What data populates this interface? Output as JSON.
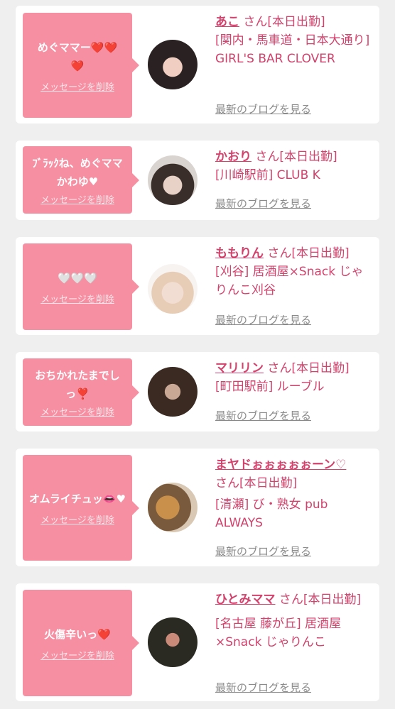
{
  "delete_label": "メッセージを削除",
  "blog_label": "最新のブログを見る",
  "cards": [
    {
      "message": "めぐママー❤️❤️❤️",
      "name": "あこ",
      "status": "さん[本日出勤]",
      "shop": "[関内・馬車道・日本大通り] GIRL'S BAR CLOVER"
    },
    {
      "message": "ﾌﾞﾗｯｸね、めぐママかわゆ♥",
      "name": "かおり",
      "status": "さん[本日出勤]",
      "shop": "[川崎駅前] CLUB K"
    },
    {
      "message": "🤍🤍🤍",
      "name": "ももりん",
      "status": "さん[本日出勤]",
      "shop": "[刈谷] 居酒屋×Snack じゃりんこ刈谷"
    },
    {
      "message": "おちかれたまでしっ❣️",
      "name": "マリリン",
      "status": "さん[本日出勤]",
      "shop": "[町田駅前] ルーブル"
    },
    {
      "message": "オムライチュッ👄♥",
      "name": "まヤドぉぉぉぉぉーン♡",
      "status": "さん[本日出勤]",
      "shop": "[清瀬] び・熟女 pub ALWAYS"
    },
    {
      "message": "火傷辛いっ❤️",
      "name": "ひとみママ",
      "status": "さん[本日出勤]",
      "shop": "[名古屋 藤が丘] 居酒屋×Snack じゃりんこ"
    }
  ]
}
